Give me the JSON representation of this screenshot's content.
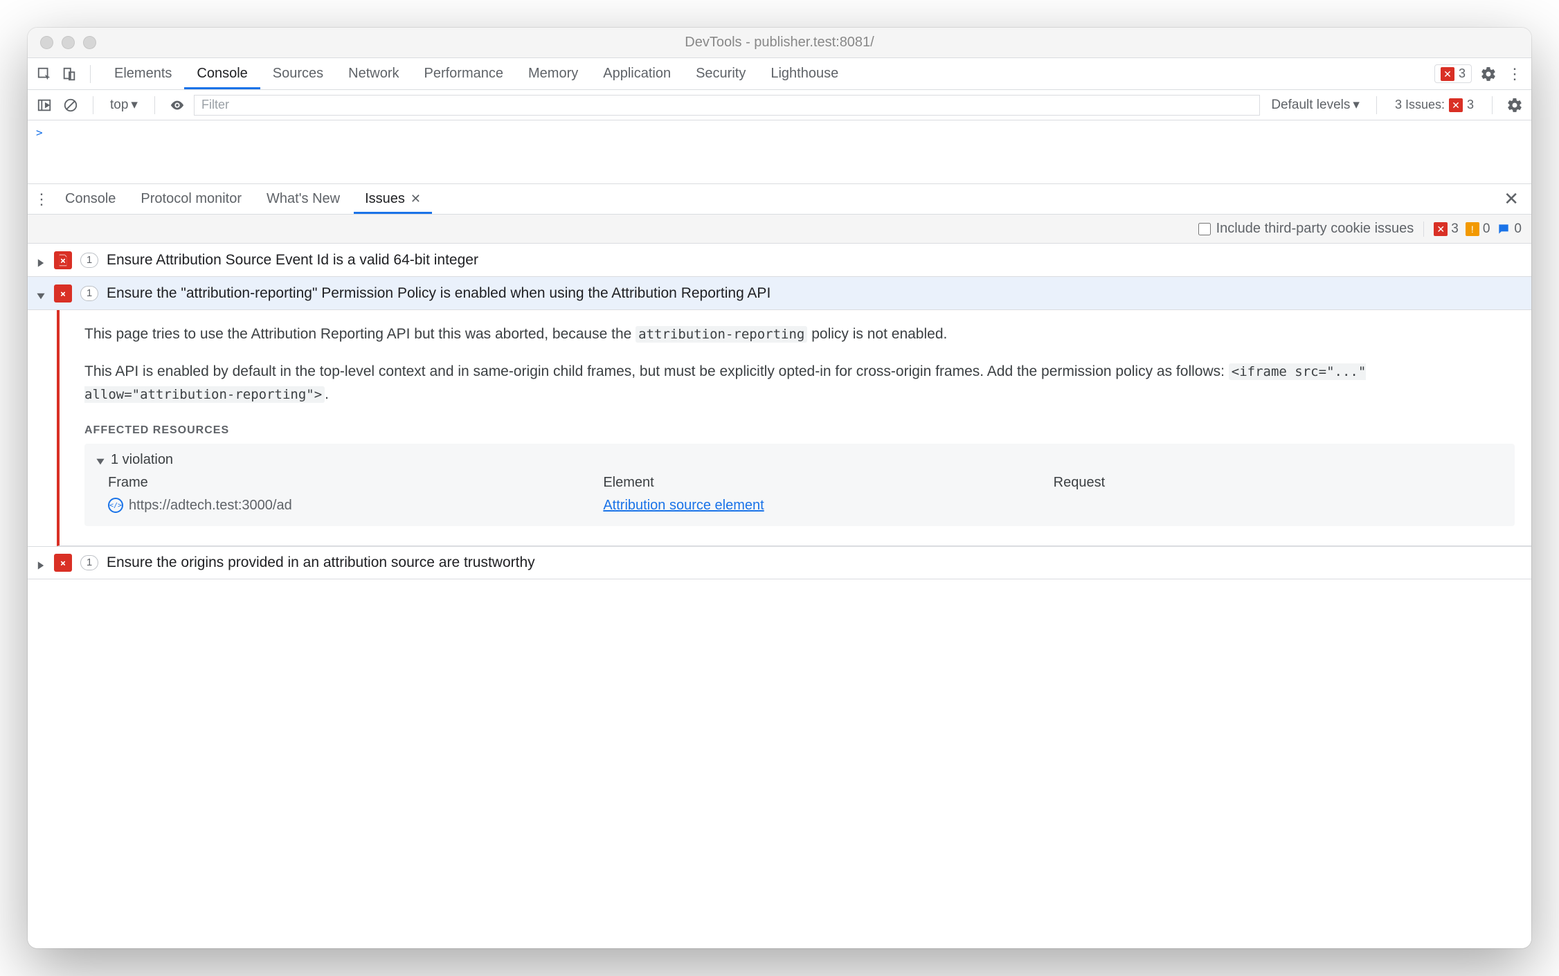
{
  "window": {
    "title": "DevTools - publisher.test:8081/"
  },
  "mainTabs": {
    "items": [
      "Elements",
      "Console",
      "Sources",
      "Network",
      "Performance",
      "Memory",
      "Application",
      "Security",
      "Lighthouse"
    ],
    "active": "Console"
  },
  "toolbarRight": {
    "errorCount": "3"
  },
  "consoleToolbar": {
    "context": "top",
    "filterPlaceholder": "Filter",
    "levels": "Default levels",
    "issuesLabel": "3 Issues:",
    "issuesCount": "3"
  },
  "drawer": {
    "tabs": [
      "Console",
      "Protocol monitor",
      "What's New",
      "Issues"
    ],
    "active": "Issues"
  },
  "issuesToolbar": {
    "thirdPartyLabel": "Include third-party cookie issues",
    "counts": {
      "error": "3",
      "warning": "0",
      "info": "0"
    }
  },
  "issues": [
    {
      "expanded": false,
      "count": "1",
      "title": "Ensure Attribution Source Event Id is a valid 64-bit integer"
    },
    {
      "expanded": true,
      "count": "1",
      "title": "Ensure the \"attribution-reporting\" Permission Policy is enabled when using the Attribution Reporting API",
      "detail": {
        "p1_a": "This page tries to use the Attribution Reporting API but this was aborted, because the ",
        "p1_code": "attribution-reporting",
        "p1_b": " policy is not enabled.",
        "p2_a": "This API is enabled by default in the top-level context and in same-origin child frames, but must be explicitly opted-in for cross-origin frames. Add the permission policy as follows: ",
        "p2_code": "<iframe src=\"...\" allow=\"attribution-reporting\">",
        "p2_b": ".",
        "affectedLabel": "AFFECTED RESOURCES",
        "violationLabel": "1 violation",
        "headers": {
          "frame": "Frame",
          "element": "Element",
          "request": "Request"
        },
        "row": {
          "frame": "https://adtech.test:3000/ad",
          "element": "Attribution source element",
          "request": ""
        }
      }
    },
    {
      "expanded": false,
      "count": "1",
      "title": "Ensure the origins provided in an attribution source are trustworthy"
    }
  ]
}
